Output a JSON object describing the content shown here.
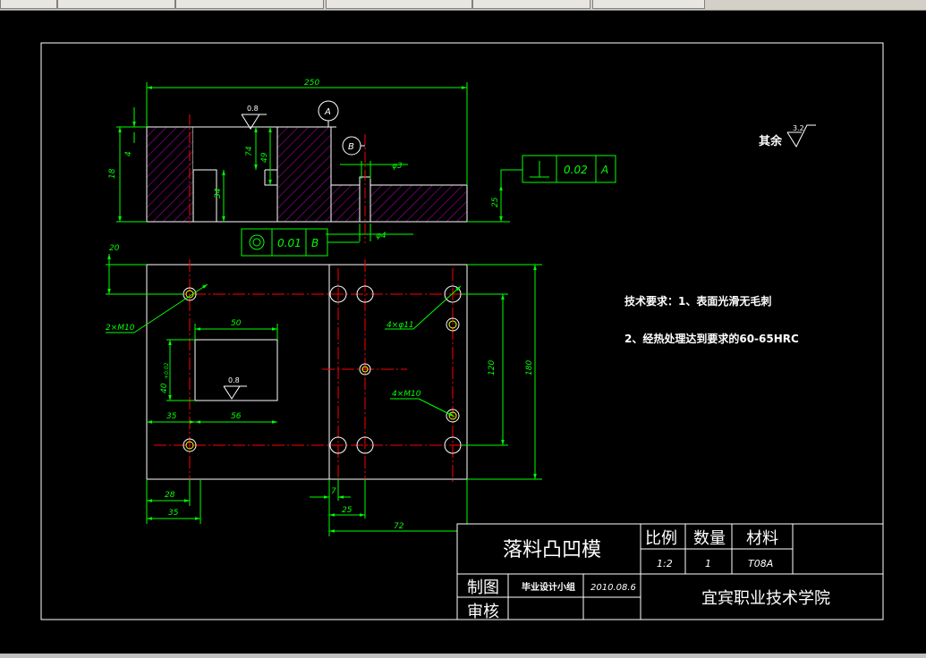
{
  "window": {
    "tabs": [
      "",
      "",
      "",
      "",
      "",
      ""
    ]
  },
  "drawing": {
    "dims": {
      "top_width": "250",
      "d_08_top": "0.8",
      "d_4": "4",
      "d_18": "18",
      "d_74": "74",
      "d_49": "49",
      "d_34": "34",
      "d_25": "25",
      "d_phi3": "φ3",
      "d_phi4": "φ4",
      "d_20": "20",
      "d_2xM10": "2×M10",
      "d_50": "50",
      "d_40": "40",
      "d_40_tol": "+0.02",
      "d_08_mid": "0.8",
      "d_35a": "35",
      "d_56": "56",
      "d_4xphi11": "4×φ11",
      "d_4xM10": "4×M10",
      "d_120": "120",
      "d_180": "180",
      "d_28": "28",
      "d_35b": "35",
      "d_7": "7",
      "d_25b": "25",
      "d_72": "72"
    },
    "datum_a": "A",
    "datum_b": "B",
    "perp_tol": {
      "symbol": "⊥",
      "value": "0.02",
      "datum": "A"
    },
    "conc_tol": {
      "symbol": "◎",
      "value": "0.01",
      "datum": "B"
    },
    "rest_roughness_label": "其余",
    "rest_roughness_value": "3.2",
    "tech_req_1": "技术要求：1、表面光滑无毛刺",
    "tech_req_2": "2、经热处理达到要求的60-65HRC"
  },
  "title_block": {
    "part_name": "落料凸凹模",
    "scale_label": "比例",
    "qty_label": "数量",
    "material_label": "材料",
    "scale_value": "1:2",
    "qty_value": "1",
    "material_value": "T08A",
    "drawn_label": "制图",
    "review_label": "审核",
    "drawn_by": "毕业设计小组",
    "date": "2010.08.6",
    "school": "宜宾职业技术学院"
  },
  "colors": {
    "background": "#000000",
    "frame": "#ffffff",
    "dimension": "#00ff00",
    "centerline": "#ff0000",
    "hatch": "#c000c0",
    "hole": "#ffff00"
  }
}
